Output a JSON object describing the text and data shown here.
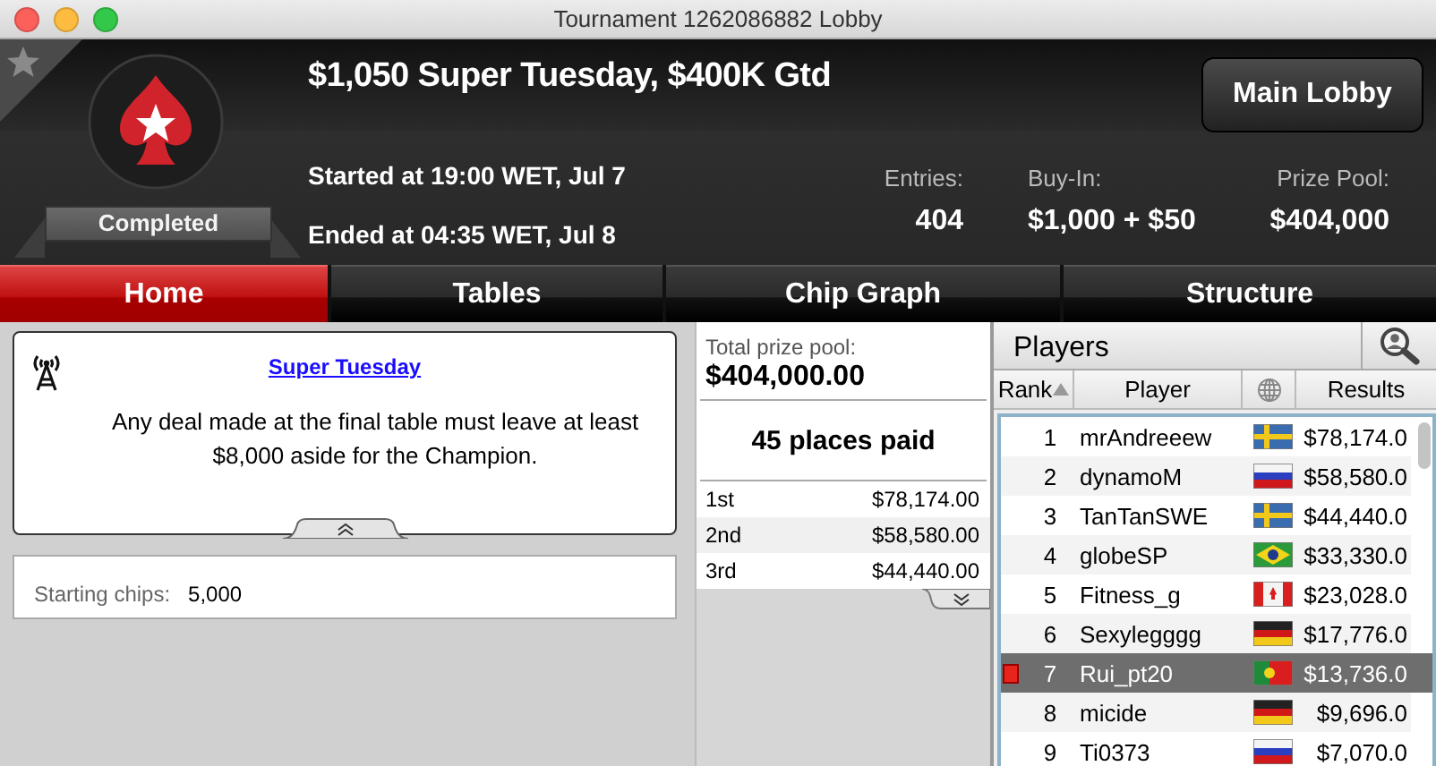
{
  "window": {
    "title": "Tournament 1262086882 Lobby"
  },
  "header": {
    "title": "$1,050 Super Tuesday, $400K Gtd",
    "status": "Completed",
    "favorite": false,
    "started": "Started at 19:00 WET, Jul 7",
    "ended": "Ended at 04:35 WET, Jul 8",
    "main_lobby_button": "Main Lobby",
    "stats": [
      {
        "label": "Entries:",
        "value": "404"
      },
      {
        "label": "Buy-In:",
        "value": "$1,000 + $50"
      },
      {
        "label": "Prize Pool:",
        "value": "$404,000"
      }
    ]
  },
  "tabs": [
    {
      "label": "Home",
      "selected": true
    },
    {
      "label": "Tables",
      "selected": false
    },
    {
      "label": "Chip Graph",
      "selected": false
    },
    {
      "label": "Structure",
      "selected": false
    }
  ],
  "notice": {
    "link": "Super Tuesday",
    "text": "Any deal made at the final table must leave at least $8,000 aside for the Champion."
  },
  "starting_chips": {
    "label": "Starting chips:",
    "value": "5,000"
  },
  "prizes": {
    "total_label": "Total prize pool:",
    "total": "$404,000.00",
    "places_paid": "45 places paid",
    "rows": [
      {
        "place": "1st",
        "amount": "$78,174.00"
      },
      {
        "place": "2nd",
        "amount": "$58,580.00"
      },
      {
        "place": "3rd",
        "amount": "$44,440.00"
      }
    ]
  },
  "players": {
    "title": "Players",
    "columns": [
      "Rank",
      "Player",
      "Results"
    ],
    "rows": [
      {
        "rank": "1",
        "name": "mrAndreeew",
        "kind": "se",
        "result": "$78,174.0",
        "selected": false
      },
      {
        "rank": "2",
        "name": "dynamoM",
        "kind": "ru",
        "result": "$58,580.0",
        "selected": false
      },
      {
        "rank": "3",
        "name": "TanTanSWE",
        "kind": "se",
        "result": "$44,440.0",
        "selected": false
      },
      {
        "rank": "4",
        "name": "globeSP",
        "kind": "br",
        "result": "$33,330.0",
        "selected": false
      },
      {
        "rank": "5",
        "name": "Fitness_g",
        "kind": "ca",
        "result": "$23,028.0",
        "selected": false
      },
      {
        "rank": "6",
        "name": "Sexylegggg",
        "kind": "de",
        "result": "$17,776.0",
        "selected": false
      },
      {
        "rank": "7",
        "name": "Rui_pt20",
        "kind": "pt",
        "result": "$13,736.0",
        "selected": true
      },
      {
        "rank": "8",
        "name": "micide",
        "kind": "de",
        "result": "$9,696.0",
        "selected": false
      },
      {
        "rank": "9",
        "name": "Ti0373",
        "kind": "ru",
        "result": "$7,070.0",
        "selected": false
      }
    ]
  }
}
